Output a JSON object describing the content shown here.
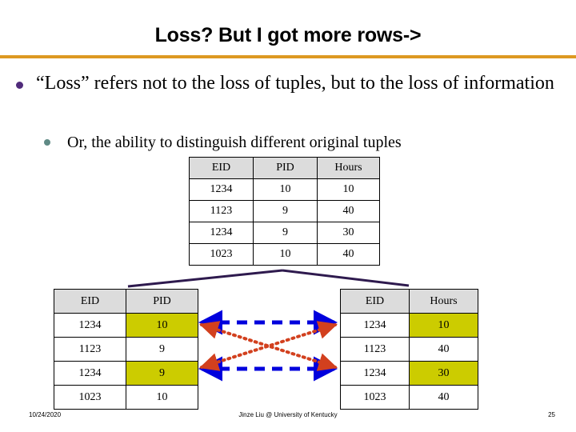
{
  "slide": {
    "title": "Loss? But I got more rows->",
    "rule_color": "#DD9922"
  },
  "bullets": {
    "level1": "“Loss” refers not to the loss of tuples, but to the loss of information",
    "level1_bullet_color": "#502B7B",
    "level2": "Or, the ability to distinguish different original tuples",
    "level2_bullet_color": "#5F8A85"
  },
  "tables": {
    "original": {
      "name": "original-relation",
      "headers": [
        "EID",
        "PID",
        "Hours"
      ],
      "rows": [
        [
          "1234",
          "10",
          "10"
        ],
        [
          "1123",
          "9",
          "40"
        ],
        [
          "1234",
          "9",
          "30"
        ],
        [
          "1023",
          "10",
          "40"
        ]
      ],
      "highlights": []
    },
    "eid_pid": {
      "name": "eid-pid-decomposition",
      "headers": [
        "EID",
        "PID"
      ],
      "rows": [
        [
          "1234",
          "10"
        ],
        [
          "1123",
          "9"
        ],
        [
          "1234",
          "9"
        ],
        [
          "1023",
          "10"
        ]
      ],
      "highlights": [
        [
          0,
          1
        ],
        [
          2,
          1
        ]
      ]
    },
    "eid_hours": {
      "name": "eid-hours-decomposition",
      "headers": [
        "EID",
        "Hours"
      ],
      "rows": [
        [
          "1234",
          "10"
        ],
        [
          "1123",
          "40"
        ],
        [
          "1234",
          "30"
        ],
        [
          "1023",
          "40"
        ]
      ],
      "highlights": [
        [
          0,
          1
        ],
        [
          2,
          1
        ]
      ]
    }
  },
  "graphics": {
    "connector_color": "#2E1A4E",
    "blue_arrow_color": "#0000DD",
    "red_arrow_color": "#D2401E",
    "header_fill": "#DCDCDC",
    "highlight_fill": "#CCCC00"
  },
  "footer": {
    "date": "10/24/2020",
    "center": "Jinze Liu @ University of Kentucky",
    "page": "25"
  }
}
